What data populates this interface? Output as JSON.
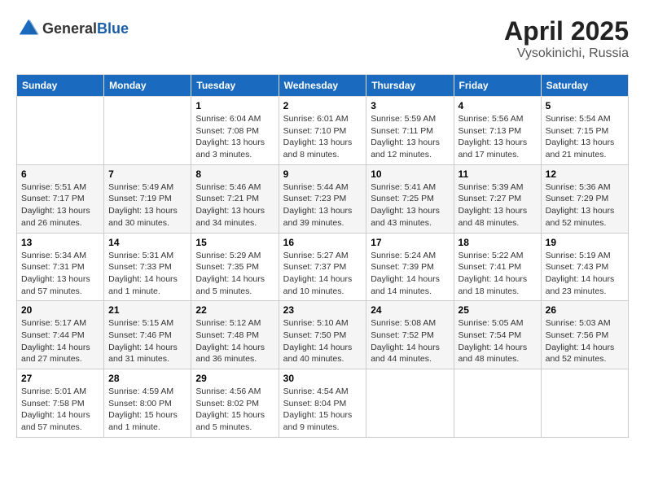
{
  "header": {
    "logo_general": "General",
    "logo_blue": "Blue",
    "month_title": "April 2025",
    "location": "Vysokinichi, Russia"
  },
  "days_of_week": [
    "Sunday",
    "Monday",
    "Tuesday",
    "Wednesday",
    "Thursday",
    "Friday",
    "Saturday"
  ],
  "weeks": [
    [
      {
        "day": "",
        "info": ""
      },
      {
        "day": "",
        "info": ""
      },
      {
        "day": "1",
        "info": "Sunrise: 6:04 AM\nSunset: 7:08 PM\nDaylight: 13 hours\nand 3 minutes."
      },
      {
        "day": "2",
        "info": "Sunrise: 6:01 AM\nSunset: 7:10 PM\nDaylight: 13 hours\nand 8 minutes."
      },
      {
        "day": "3",
        "info": "Sunrise: 5:59 AM\nSunset: 7:11 PM\nDaylight: 13 hours\nand 12 minutes."
      },
      {
        "day": "4",
        "info": "Sunrise: 5:56 AM\nSunset: 7:13 PM\nDaylight: 13 hours\nand 17 minutes."
      },
      {
        "day": "5",
        "info": "Sunrise: 5:54 AM\nSunset: 7:15 PM\nDaylight: 13 hours\nand 21 minutes."
      }
    ],
    [
      {
        "day": "6",
        "info": "Sunrise: 5:51 AM\nSunset: 7:17 PM\nDaylight: 13 hours\nand 26 minutes."
      },
      {
        "day": "7",
        "info": "Sunrise: 5:49 AM\nSunset: 7:19 PM\nDaylight: 13 hours\nand 30 minutes."
      },
      {
        "day": "8",
        "info": "Sunrise: 5:46 AM\nSunset: 7:21 PM\nDaylight: 13 hours\nand 34 minutes."
      },
      {
        "day": "9",
        "info": "Sunrise: 5:44 AM\nSunset: 7:23 PM\nDaylight: 13 hours\nand 39 minutes."
      },
      {
        "day": "10",
        "info": "Sunrise: 5:41 AM\nSunset: 7:25 PM\nDaylight: 13 hours\nand 43 minutes."
      },
      {
        "day": "11",
        "info": "Sunrise: 5:39 AM\nSunset: 7:27 PM\nDaylight: 13 hours\nand 48 minutes."
      },
      {
        "day": "12",
        "info": "Sunrise: 5:36 AM\nSunset: 7:29 PM\nDaylight: 13 hours\nand 52 minutes."
      }
    ],
    [
      {
        "day": "13",
        "info": "Sunrise: 5:34 AM\nSunset: 7:31 PM\nDaylight: 13 hours\nand 57 minutes."
      },
      {
        "day": "14",
        "info": "Sunrise: 5:31 AM\nSunset: 7:33 PM\nDaylight: 14 hours\nand 1 minute."
      },
      {
        "day": "15",
        "info": "Sunrise: 5:29 AM\nSunset: 7:35 PM\nDaylight: 14 hours\nand 5 minutes."
      },
      {
        "day": "16",
        "info": "Sunrise: 5:27 AM\nSunset: 7:37 PM\nDaylight: 14 hours\nand 10 minutes."
      },
      {
        "day": "17",
        "info": "Sunrise: 5:24 AM\nSunset: 7:39 PM\nDaylight: 14 hours\nand 14 minutes."
      },
      {
        "day": "18",
        "info": "Sunrise: 5:22 AM\nSunset: 7:41 PM\nDaylight: 14 hours\nand 18 minutes."
      },
      {
        "day": "19",
        "info": "Sunrise: 5:19 AM\nSunset: 7:43 PM\nDaylight: 14 hours\nand 23 minutes."
      }
    ],
    [
      {
        "day": "20",
        "info": "Sunrise: 5:17 AM\nSunset: 7:44 PM\nDaylight: 14 hours\nand 27 minutes."
      },
      {
        "day": "21",
        "info": "Sunrise: 5:15 AM\nSunset: 7:46 PM\nDaylight: 14 hours\nand 31 minutes."
      },
      {
        "day": "22",
        "info": "Sunrise: 5:12 AM\nSunset: 7:48 PM\nDaylight: 14 hours\nand 36 minutes."
      },
      {
        "day": "23",
        "info": "Sunrise: 5:10 AM\nSunset: 7:50 PM\nDaylight: 14 hours\nand 40 minutes."
      },
      {
        "day": "24",
        "info": "Sunrise: 5:08 AM\nSunset: 7:52 PM\nDaylight: 14 hours\nand 44 minutes."
      },
      {
        "day": "25",
        "info": "Sunrise: 5:05 AM\nSunset: 7:54 PM\nDaylight: 14 hours\nand 48 minutes."
      },
      {
        "day": "26",
        "info": "Sunrise: 5:03 AM\nSunset: 7:56 PM\nDaylight: 14 hours\nand 52 minutes."
      }
    ],
    [
      {
        "day": "27",
        "info": "Sunrise: 5:01 AM\nSunset: 7:58 PM\nDaylight: 14 hours\nand 57 minutes."
      },
      {
        "day": "28",
        "info": "Sunrise: 4:59 AM\nSunset: 8:00 PM\nDaylight: 15 hours\nand 1 minute."
      },
      {
        "day": "29",
        "info": "Sunrise: 4:56 AM\nSunset: 8:02 PM\nDaylight: 15 hours\nand 5 minutes."
      },
      {
        "day": "30",
        "info": "Sunrise: 4:54 AM\nSunset: 8:04 PM\nDaylight: 15 hours\nand 9 minutes."
      },
      {
        "day": "",
        "info": ""
      },
      {
        "day": "",
        "info": ""
      },
      {
        "day": "",
        "info": ""
      }
    ]
  ]
}
